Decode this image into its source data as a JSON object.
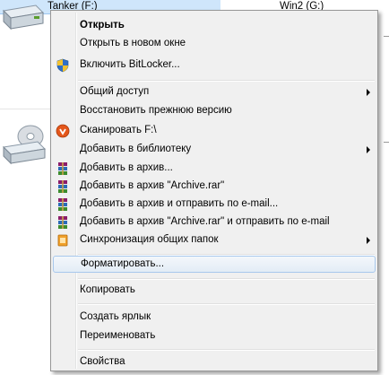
{
  "explorer": {
    "drive1_label": "Tanker (F:)",
    "drive2_label": "Win2 (G:)"
  },
  "menu": {
    "items": [
      {
        "label": "Открыть",
        "icon": null
      },
      {
        "label": "Открыть в новом окне",
        "icon": null
      },
      {
        "label": "Включить BitLocker...",
        "icon": "shield-icon"
      },
      {
        "label": "Общий доступ",
        "icon": null
      },
      {
        "label": "Восстановить прежнюю версию",
        "icon": null
      },
      {
        "label": "Сканировать F:\\",
        "icon": "antivirus-icon"
      },
      {
        "label": "Добавить в библиотеку",
        "icon": null
      },
      {
        "label": "Добавить в архив...",
        "icon": "winrar-icon"
      },
      {
        "label": "Добавить в архив \"Archive.rar\"",
        "icon": "winrar-icon"
      },
      {
        "label": "Добавить в архив и отправить по e-mail...",
        "icon": "winrar-icon"
      },
      {
        "label": "Добавить в архив \"Archive.rar\" и отправить по e-mail",
        "icon": "winrar-icon"
      },
      {
        "label": "Синхронизация общих папок",
        "icon": "sync-icon"
      },
      {
        "label": "Форматировать...",
        "icon": null
      },
      {
        "label": "Копировать",
        "icon": null
      },
      {
        "label": "Создать ярлык",
        "icon": null
      },
      {
        "label": "Переименовать",
        "icon": null
      },
      {
        "label": "Свойства",
        "icon": null
      }
    ]
  },
  "colors": {
    "menu_bg": "#f0f0f0",
    "highlight_border": "#a8c8ec",
    "selected_row": "#cfe6fb"
  }
}
